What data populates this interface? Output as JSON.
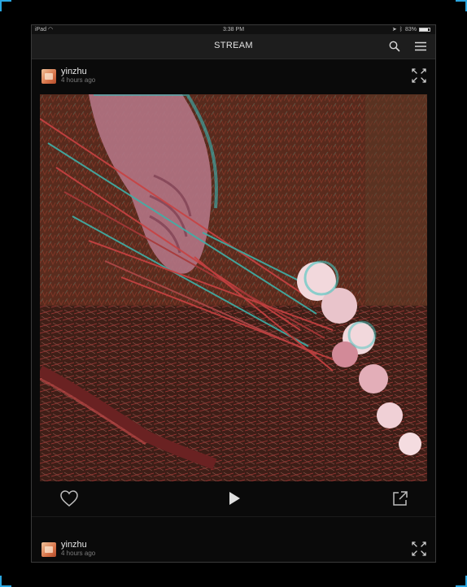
{
  "status_bar": {
    "device": "iPad",
    "time": "3:38 PM",
    "battery_percent": "83%",
    "battery_level": 0.83
  },
  "navbar": {
    "title": "STREAM",
    "icons": [
      "search-icon",
      "menu-icon"
    ]
  },
  "posts": [
    {
      "user": "yinzhu",
      "time_ago": "4 hours ago",
      "media": "anaglyph photo of a hand holding a bundle of twigs with pink flowers on the forest floor",
      "actions": [
        "heart-icon",
        "play-icon",
        "share-icon"
      ]
    },
    {
      "user": "yinzhu",
      "time_ago": "4 hours ago"
    }
  ],
  "colors": {
    "background": "#000000",
    "frame_accent": "#2aa6e0",
    "navbar": "#1d1d1d",
    "text_primary": "#e8e8e8",
    "text_secondary": "#7c7c7c"
  }
}
